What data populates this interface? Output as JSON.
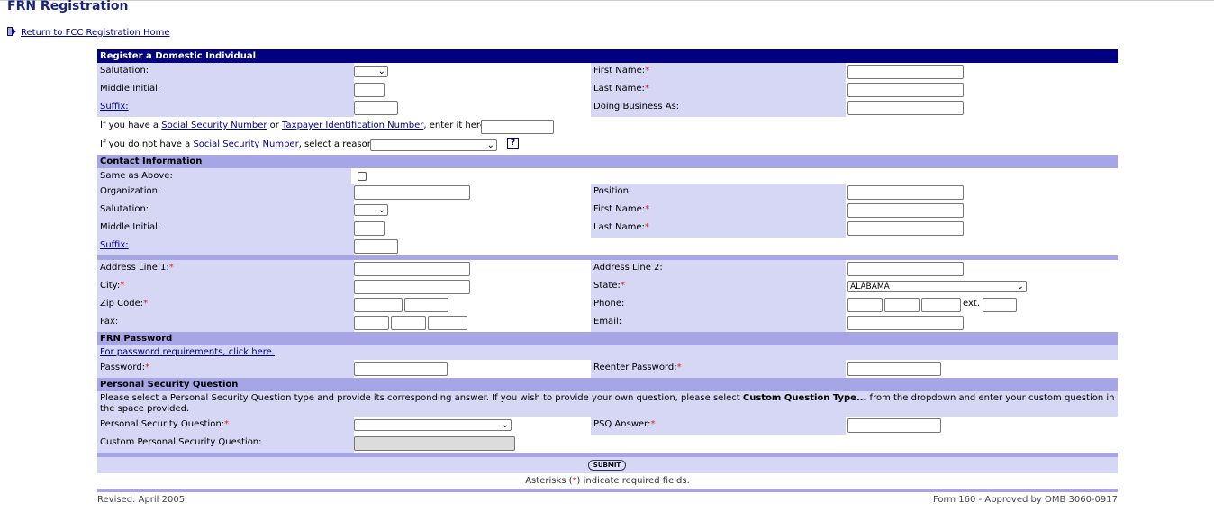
{
  "page": {
    "title": "FRN Registration",
    "return_link": "Return to FCC Registration Home"
  },
  "individual": {
    "header": "Register a Domestic Individual",
    "salutation": "Salutation:",
    "first_name": "First Name:",
    "middle_initial": "Middle Initial:",
    "last_name": "Last Name:",
    "suffix": "Suffix:",
    "dba": "Doing Business As:",
    "ssn_prefix": "If you have a ",
    "ssn_link": "Social Security Number",
    "ssn_or": " or ",
    "tin_link": "Taxpayer Identification Number",
    "ssn_suffix": ", enter it here:",
    "nossn_prefix": "If you do not have a ",
    "nossn_link": "Social Security Number",
    "nossn_suffix": ", select a reason:",
    "help_icon": "?"
  },
  "contact": {
    "header": "Contact Information",
    "same_as_above": "Same as Above:",
    "organization": "Organization:",
    "position": "Position:",
    "salutation": "Salutation:",
    "first_name": "First Name:",
    "middle_initial": "Middle Initial:",
    "last_name": "Last Name:",
    "suffix": "Suffix:",
    "address1": "Address Line 1:",
    "address2": "Address Line 2:",
    "city": "City:",
    "state": "State:",
    "state_value": "ALABAMA",
    "zip": "Zip Code:",
    "phone": "Phone:",
    "ext": "ext.",
    "fax": "Fax:",
    "email": "Email:"
  },
  "password": {
    "header": "FRN Password",
    "requirements_link": "For password requirements, click here.",
    "password": "Password:",
    "reenter": "Reenter Password:"
  },
  "psq": {
    "header": "Personal Security Question",
    "instructions_a": "Please select a Personal Security Question type and provide its corresponding answer. If you wish to provide your own question, please select ",
    "instructions_bold": "Custom Question Type...",
    "instructions_b": " from the dropdown and enter your custom question in the space provided.",
    "question": "Personal Security Question:",
    "answer": "PSQ Answer:",
    "custom": "Custom Personal Security Question:"
  },
  "submit_label": "SUBMIT",
  "required_note_a": "Asterisks (",
  "required_mark": "*",
  "required_note_b": ") indicate required fields.",
  "footer": {
    "revised": "Revised: April 2005",
    "form": "Form 160 - Approved by OMB 3060-0917"
  },
  "colors": {
    "header_dark": "#000080",
    "section": "#a6a6e6",
    "label_bg": "#d6d6f5",
    "required": "#e02020"
  }
}
